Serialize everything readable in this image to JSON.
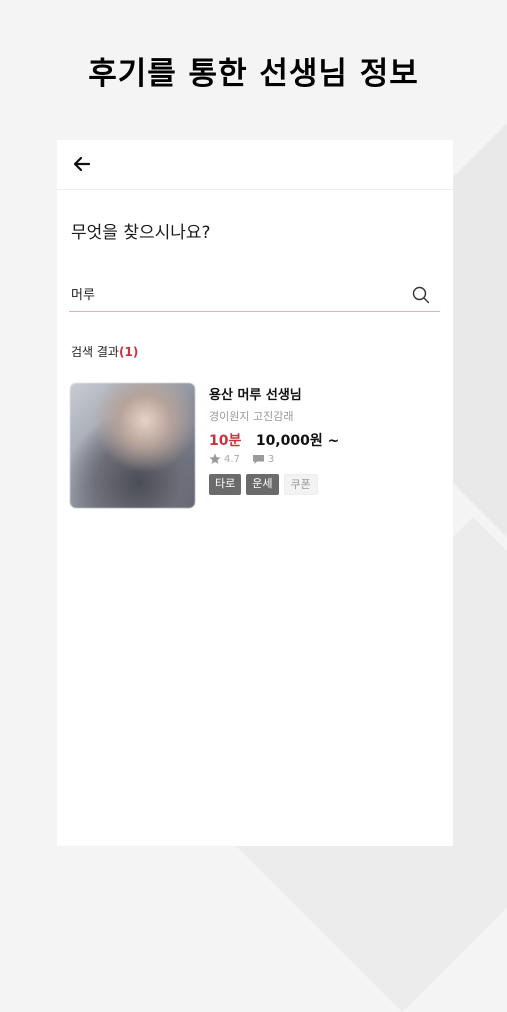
{
  "promo": {
    "headline": "후기를 통한 선생님 정보"
  },
  "screen": {
    "question": "무엇을 찾으시나요?",
    "search": {
      "value": "머루",
      "placeholder": ""
    },
    "results": {
      "label": "검색 결과",
      "count": "(1)"
    }
  },
  "teacher": {
    "name": "용산 머루 선생님",
    "categories": "경이원지 고진감래",
    "minutes": "10분",
    "price": "10,000원 ~",
    "rating": "4.7",
    "reviews": "3",
    "tags": [
      "타로",
      "운세",
      "쿠폰"
    ]
  },
  "colors": {
    "accent": "#d0303f",
    "tag_dark": "#6b6b6b"
  },
  "icons": {
    "back": "arrow-left-icon",
    "search": "search-icon",
    "rating": "star-icon",
    "reviews": "comment-icon"
  }
}
